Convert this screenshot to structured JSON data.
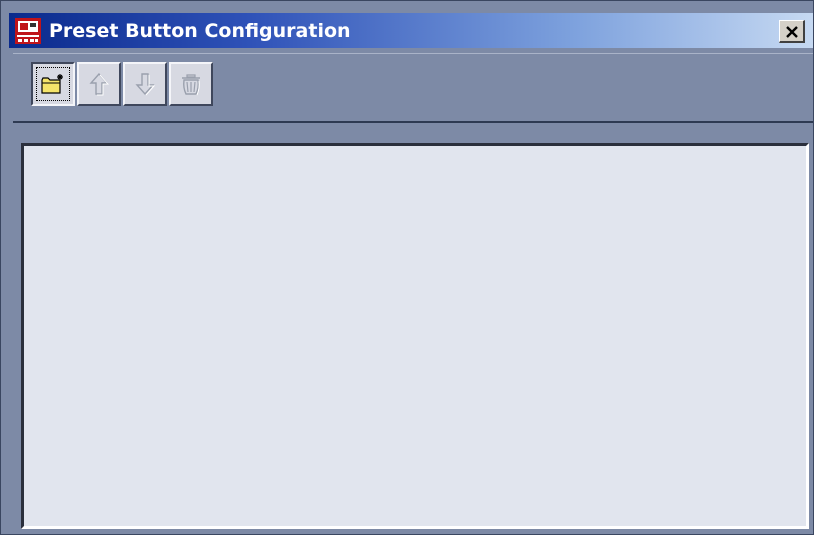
{
  "window": {
    "title": "Preset Button Configuration",
    "app_icon": "video-camera-app-icon",
    "close_glyph": "×"
  },
  "toolbar": {
    "buttons": [
      {
        "name": "new-preset-button",
        "icon": "new-folder-sparkle-icon",
        "enabled": true,
        "focused": true
      },
      {
        "name": "move-up-button",
        "icon": "arrow-up-icon",
        "enabled": false
      },
      {
        "name": "move-down-button",
        "icon": "arrow-down-icon",
        "enabled": false
      },
      {
        "name": "delete-button",
        "icon": "trash-can-icon",
        "enabled": false
      }
    ]
  },
  "list": {
    "items": []
  },
  "colors": {
    "title_start": "#0a2a8c",
    "title_end": "#c6d9f2",
    "window_bg": "#7d8aa6",
    "list_bg": "#e1e5ee"
  }
}
